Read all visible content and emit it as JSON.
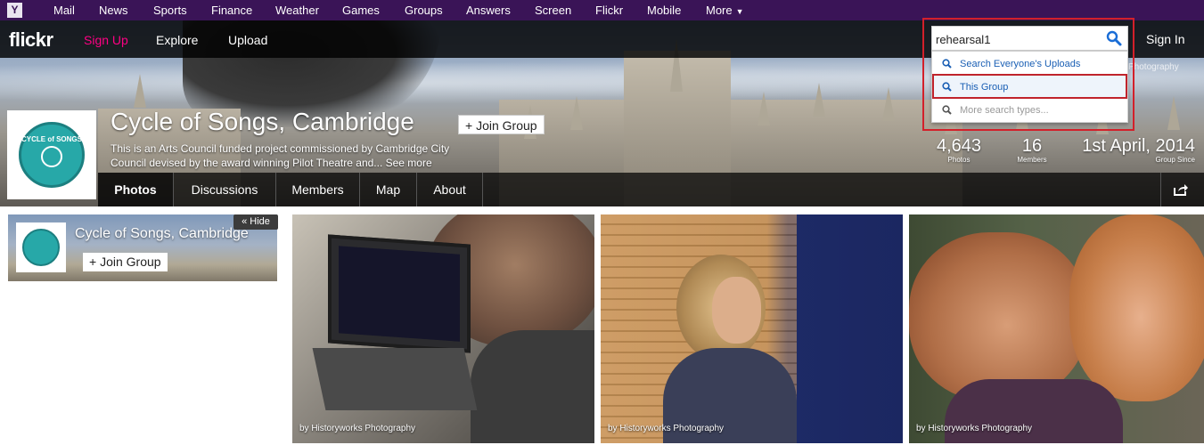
{
  "yahoo_bar": {
    "logo": "Y",
    "links": [
      "Mail",
      "News",
      "Sports",
      "Finance",
      "Weather",
      "Games",
      "Groups",
      "Answers",
      "Screen",
      "Flickr",
      "Mobile",
      "More"
    ]
  },
  "flickr_nav": {
    "logo": "flickr",
    "sign_up": "Sign Up",
    "explore": "Explore",
    "upload": "Upload",
    "sign_in": "Sign In"
  },
  "search": {
    "value": "rehearsal1",
    "suggestions": [
      "Search Everyone's Uploads",
      "This Group",
      "More search types..."
    ]
  },
  "hero_credit": "Photography",
  "group": {
    "title": "Cycle of Songs, Cambridge",
    "join_label": "+ Join Group",
    "description": "This is an Arts Council funded project commissioned by Cambridge City Council devised by the award winning Pilot Theatre and... See more",
    "logo_text": "CYCLE of SONGS",
    "stats": [
      {
        "value": "4,643",
        "label": "Photos"
      },
      {
        "value": "16",
        "label": "Members"
      },
      {
        "value": "1st April, 2014",
        "label": "Group Since"
      }
    ]
  },
  "tabs": [
    "Photos",
    "Discussions",
    "Members",
    "Map",
    "About"
  ],
  "mini_card": {
    "title": "Cycle of Songs, Cambridge",
    "join_label": "+ Join Group",
    "hide_label": "« Hide"
  },
  "photos": [
    {
      "credit": "by Historyworks Photography"
    },
    {
      "credit": "by Historyworks Photography"
    },
    {
      "credit": "by Historyworks Photography"
    }
  ],
  "colors": {
    "yahoo_purple": "#3a1457",
    "flickr_pink": "#ff0084",
    "highlight_red": "#d3202a",
    "link_blue": "#1a5fb4"
  }
}
